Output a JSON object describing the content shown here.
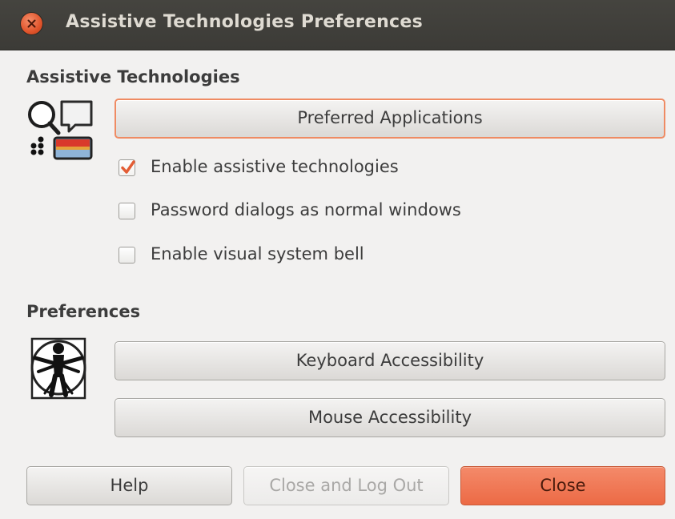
{
  "window": {
    "title": "Assistive Technologies Preferences"
  },
  "assistive": {
    "heading": "Assistive Technologies",
    "preferred_apps_label": "Preferred Applications",
    "checkboxes": [
      {
        "label": "Enable assistive technologies",
        "checked": true
      },
      {
        "label": "Password dialogs as normal windows",
        "checked": false
      },
      {
        "label": "Enable visual system bell",
        "checked": false
      }
    ]
  },
  "preferences": {
    "heading": "Preferences",
    "keyboard_label": "Keyboard Accessibility",
    "mouse_label": "Mouse Accessibility"
  },
  "actions": {
    "help_label": "Help",
    "logout_label": "Close and Log Out",
    "close_label": "Close"
  },
  "icons": {
    "window_close": "close-icon",
    "assistive": "assistive-technologies-icon",
    "accessibility": "vitruvian-man-icon",
    "checkmark": "checkmark-icon"
  },
  "colors": {
    "accent": "#ec6a45",
    "titlebar": "#3c3b37",
    "background": "#f2f1f0"
  }
}
